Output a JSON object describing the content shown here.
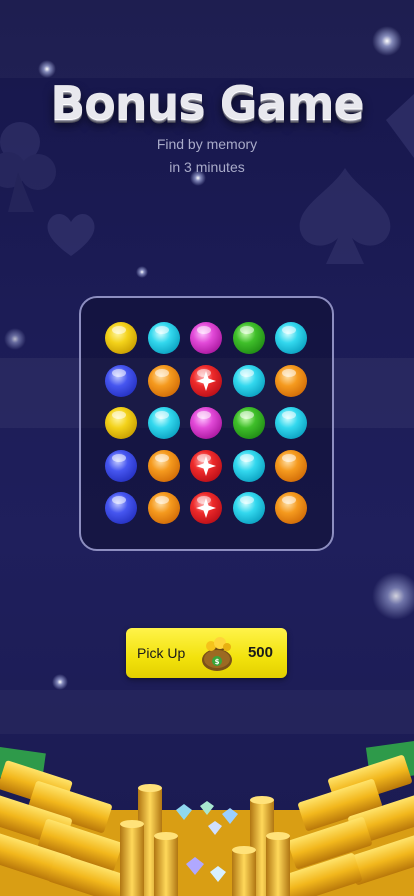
{
  "game": {
    "title": "Bonus Game",
    "subtitle_line1": "Find by memory",
    "subtitle_line2": "in 3 minutes"
  },
  "board": {
    "rows": [
      [
        "yellow",
        "cyan",
        "magenta",
        "green",
        "cyan"
      ],
      [
        "blue",
        "orange",
        "red-star",
        "cyan",
        "orange"
      ],
      [
        "yellow",
        "cyan",
        "magenta",
        "green",
        "cyan"
      ],
      [
        "blue",
        "orange",
        "red-star",
        "cyan",
        "orange"
      ],
      [
        "blue",
        "orange",
        "red-star",
        "cyan",
        "orange"
      ]
    ]
  },
  "pickup": {
    "label": "Pick Up",
    "value": "500",
    "icon": "money-bag-icon"
  },
  "colors": {
    "background": "#1c1c56",
    "board_border": "#8d8ec0",
    "button": "#f2e20c"
  }
}
